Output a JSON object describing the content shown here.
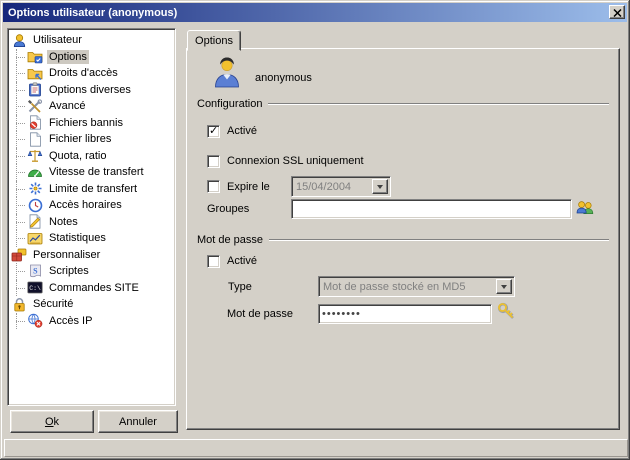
{
  "window": {
    "title": "Options utilisateur (anonymous)",
    "close_icon": "close-icon"
  },
  "sidebar": {
    "items": [
      {
        "id": "utilisateur",
        "label": "Utilisateur",
        "icon": "user-icon",
        "depth": 0,
        "selected": false
      },
      {
        "id": "options",
        "label": "Options",
        "icon": "folder-check-icon",
        "depth": 1,
        "selected": true
      },
      {
        "id": "droits-acces",
        "label": "Droits d'accès",
        "icon": "folder-access-icon",
        "depth": 1,
        "selected": false
      },
      {
        "id": "options-diverses",
        "label": "Options diverses",
        "icon": "misc-options-icon",
        "depth": 1,
        "selected": false
      },
      {
        "id": "avance",
        "label": "Avancé",
        "icon": "tools-icon",
        "depth": 1,
        "selected": false
      },
      {
        "id": "fichiers-bannis",
        "label": "Fichiers bannis",
        "icon": "banned-file-icon",
        "depth": 1,
        "selected": false
      },
      {
        "id": "fichier-libres",
        "label": "Fichier libres",
        "icon": "free-file-icon",
        "depth": 1,
        "selected": false
      },
      {
        "id": "quota-ratio",
        "label": "Quota, ratio",
        "icon": "quota-icon",
        "depth": 1,
        "selected": false
      },
      {
        "id": "vitesse-transfert",
        "label": "Vitesse de transfert",
        "icon": "speed-icon",
        "depth": 1,
        "selected": false
      },
      {
        "id": "limite-transfert",
        "label": "Limite de transfert",
        "icon": "transfer-limit-icon",
        "depth": 1,
        "selected": false
      },
      {
        "id": "acces-horaires",
        "label": "Accès horaires",
        "icon": "clock-icon",
        "depth": 1,
        "selected": false
      },
      {
        "id": "notes",
        "label": "Notes",
        "icon": "notes-icon",
        "depth": 1,
        "selected": false
      },
      {
        "id": "statistiques",
        "label": "Statistiques",
        "icon": "stats-icon",
        "depth": 1,
        "selected": false
      },
      {
        "id": "personnaliser",
        "label": "Personnaliser",
        "icon": "personalize-icon",
        "depth": 0,
        "selected": false
      },
      {
        "id": "scriptes",
        "label": "Scriptes",
        "icon": "script-icon",
        "depth": 1,
        "selected": false
      },
      {
        "id": "commandes-site",
        "label": "Commandes SITE",
        "icon": "site-commands-icon",
        "depth": 1,
        "selected": false
      },
      {
        "id": "securite",
        "label": "Sécurité",
        "icon": "security-icon",
        "depth": 0,
        "selected": false
      },
      {
        "id": "acces-ip",
        "label": "Accès IP",
        "icon": "ip-access-icon",
        "depth": 1,
        "selected": false
      }
    ]
  },
  "panel": {
    "tab_label": "Options",
    "username": "anonymous",
    "avatar_icon": "user-avatar-icon",
    "configuration": {
      "title": "Configuration",
      "active": {
        "label": "Activé",
        "checked": true
      },
      "ssl_only": {
        "label": "Connexion SSL uniquement",
        "checked": false
      },
      "expires": {
        "label": "Expire le",
        "checked": false,
        "date_value": "15/04/2004"
      },
      "groups": {
        "label": "Groupes",
        "value": "",
        "icon": "groups-icon"
      }
    },
    "password_section": {
      "title": "Mot de passe",
      "active": {
        "label": "Activé",
        "checked": false
      },
      "type": {
        "label": "Type",
        "value": "Mot de passe stocké en MD5"
      },
      "password": {
        "label": "Mot de passe",
        "value": "••••••••",
        "icon": "key-icon"
      }
    }
  },
  "buttons": {
    "ok": "Ok",
    "cancel": "Annuler"
  },
  "colors": {
    "dialog_bg": "#d4d0c8",
    "titlebar_gradient_start": "#16277b",
    "titlebar_gradient_end": "#9cbdea",
    "titlebar_text": "#ffffff",
    "disabled_text": "#808080",
    "selection_bg": "#cdc9c1"
  }
}
